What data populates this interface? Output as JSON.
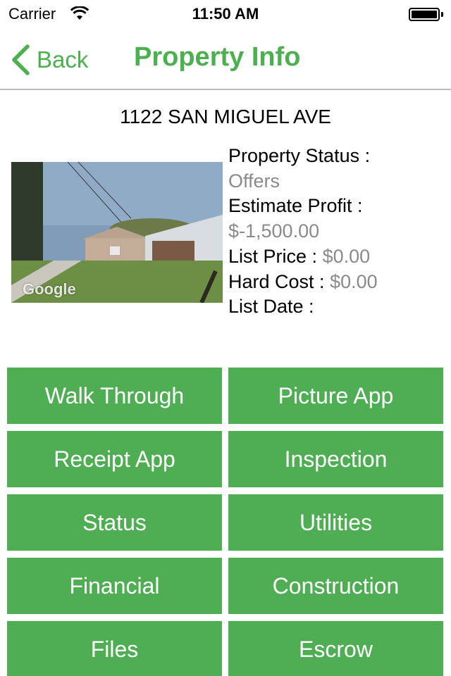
{
  "status_bar": {
    "carrier": "Carrier",
    "time": "11:50 AM",
    "wifi_icon": "wifi-icon",
    "battery_icon": "battery-icon",
    "battery_level": 1.0
  },
  "nav": {
    "back_label": "Back",
    "back_icon": "chevron-left-icon",
    "title": "Property Info"
  },
  "property": {
    "address": "1122 SAN MIGUEL AVE",
    "photo_watermark": "Google",
    "status_label": "Property Status :",
    "status_value": "Offers",
    "profit_label": "Estimate Profit :",
    "profit_value": "$-1,500.00",
    "list_price_label": "List Price :",
    "list_price_value": "$0.00",
    "hard_cost_label": "Hard Cost :",
    "hard_cost_value": "$0.00",
    "list_date_label": "List Date :",
    "list_date_value": ""
  },
  "colors": {
    "accent": "#4caf50",
    "tile": "#4fae53",
    "value_gray": "#8a8a8a"
  },
  "actions": [
    {
      "label": "Walk Through"
    },
    {
      "label": "Picture App"
    },
    {
      "label": "Receipt App"
    },
    {
      "label": "Inspection"
    },
    {
      "label": "Status"
    },
    {
      "label": "Utilities"
    },
    {
      "label": "Financial"
    },
    {
      "label": "Construction"
    },
    {
      "label": "Files"
    },
    {
      "label": "Escrow"
    }
  ]
}
